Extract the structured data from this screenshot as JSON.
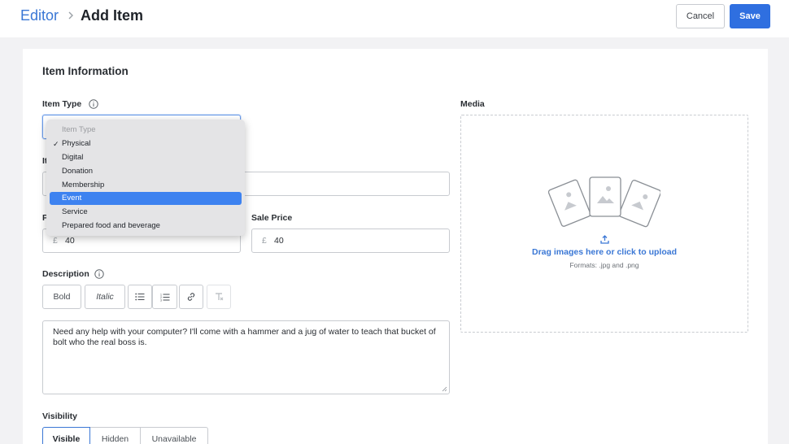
{
  "header": {
    "breadcrumb_parent": "Editor",
    "title": "Add Item",
    "cancel_label": "Cancel",
    "save_label": "Save"
  },
  "form": {
    "section_title": "Item Information",
    "item_type": {
      "label": "Item Type",
      "options": [
        {
          "label": "Item Type",
          "disabled": true
        },
        {
          "label": "Physical",
          "checked": true
        },
        {
          "label": "Digital"
        },
        {
          "label": "Donation"
        },
        {
          "label": "Membership"
        },
        {
          "label": "Event",
          "highlighted": true
        },
        {
          "label": "Service"
        },
        {
          "label": "Prepared food and beverage"
        }
      ]
    },
    "item_name": {
      "label_fragment": "It"
    },
    "price": {
      "label_fragment": "P",
      "currency": "£",
      "value": "40"
    },
    "sale_price": {
      "label": "Sale Price",
      "currency": "£",
      "value": "40"
    },
    "description": {
      "label": "Description",
      "toolbar": {
        "bold": "Bold",
        "italic": "Italic",
        "bullet_list_icon": "bullet-list-icon",
        "numbered_list_icon": "numbered-list-icon",
        "link_icon": "link-icon",
        "clear_format_icon": "clear-format-icon"
      },
      "text": "Need any help with your computer? I'll come with a hammer and a jug of water to teach that bucket of bolt who the real boss is."
    },
    "visibility": {
      "label": "Visibility",
      "options": [
        "Visible",
        "Hidden",
        "Unavailable"
      ],
      "selected": "Visible"
    }
  },
  "media": {
    "label": "Media",
    "upload_text": "Drag images here or click to upload",
    "formats": "Formats: .jpg and .png",
    "upload_icon": "upload-icon"
  },
  "colors": {
    "accent": "#2f6fe0",
    "link": "#3a77d5",
    "highlight": "#3d82f0"
  }
}
